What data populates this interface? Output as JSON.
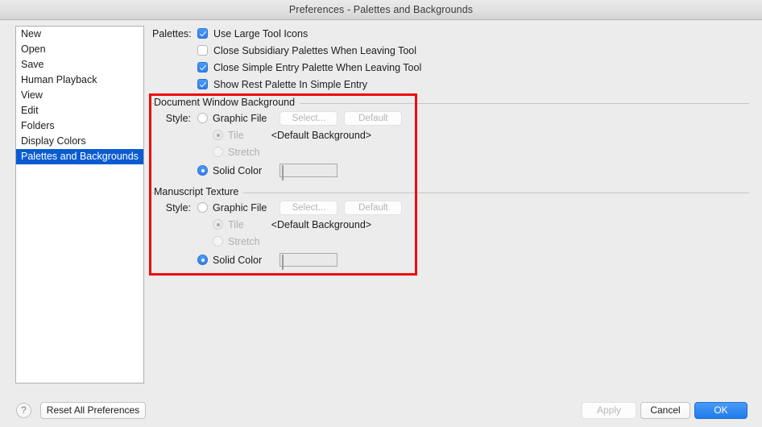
{
  "window": {
    "title": "Preferences - Palettes and Backgrounds"
  },
  "sidebar": {
    "items": [
      {
        "label": "New",
        "selected": false
      },
      {
        "label": "Open",
        "selected": false
      },
      {
        "label": "Save",
        "selected": false
      },
      {
        "label": "Human Playback",
        "selected": false
      },
      {
        "label": "View",
        "selected": false
      },
      {
        "label": "Edit",
        "selected": false
      },
      {
        "label": "Folders",
        "selected": false
      },
      {
        "label": "Display Colors",
        "selected": false
      },
      {
        "label": "Palettes and Backgrounds",
        "selected": true
      }
    ]
  },
  "palettes": {
    "label": "Palettes:",
    "options": [
      {
        "label": "Use Large Tool Icons",
        "checked": true
      },
      {
        "label": "Close Subsidiary Palettes When Leaving Tool",
        "checked": false
      },
      {
        "label": "Close Simple Entry Palette When Leaving Tool",
        "checked": true
      },
      {
        "label": "Show Rest Palette In Simple Entry",
        "checked": true
      }
    ]
  },
  "document_window_background": {
    "title": "Document Window Background",
    "style_label": "Style:",
    "graphic_file_label": "Graphic File",
    "graphic_file_selected": false,
    "select_button": "Select...",
    "default_button": "Default",
    "tile_label": "Tile",
    "tile_selected": true,
    "stretch_label": "Stretch",
    "stretch_selected": false,
    "background_name": "<Default Background>",
    "solid_color_label": "Solid Color",
    "solid_color_selected": true,
    "swatch_color": "#eef6ec"
  },
  "manuscript_texture": {
    "title": "Manuscript Texture",
    "style_label": "Style:",
    "graphic_file_label": "Graphic File",
    "graphic_file_selected": false,
    "select_button": "Select...",
    "default_button": "Default",
    "tile_label": "Tile",
    "tile_selected": true,
    "stretch_label": "Stretch",
    "stretch_selected": false,
    "background_name": "<Default Background>",
    "solid_color_label": "Solid Color",
    "solid_color_selected": true,
    "swatch_color": "#eef6ec"
  },
  "footer": {
    "help_label": "?",
    "reset_label": "Reset All Preferences",
    "apply_label": "Apply",
    "cancel_label": "Cancel",
    "ok_label": "OK"
  },
  "annotation": {
    "color": "#ee0b0b"
  },
  "colors": {
    "selection_blue": "#0a5bd3",
    "control_blue": "#2f7ef0",
    "window_background": "#ececec",
    "list_background": "#ffffff"
  }
}
